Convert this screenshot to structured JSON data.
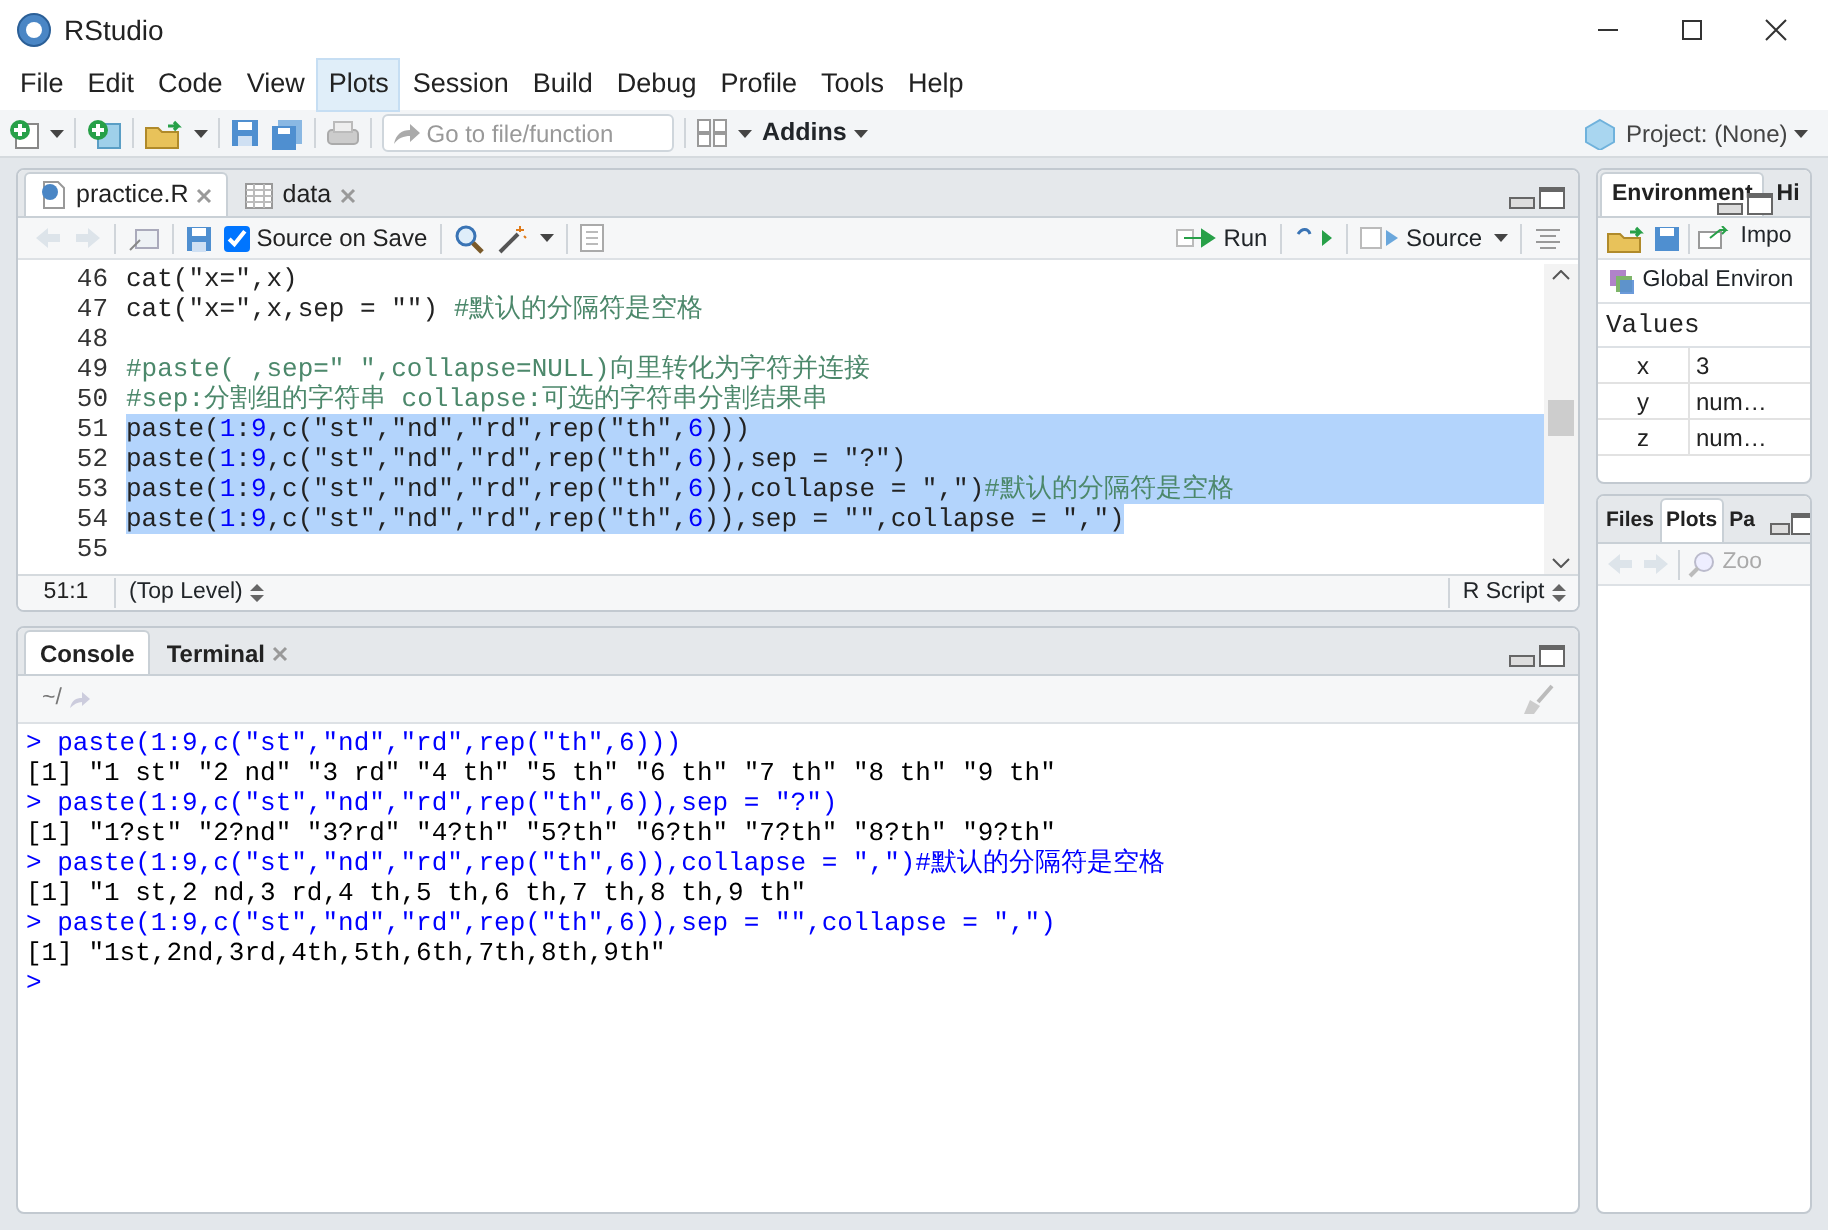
{
  "window": {
    "title": "RStudio"
  },
  "menu": [
    {
      "label": "File",
      "selected": false
    },
    {
      "label": "Edit",
      "selected": false
    },
    {
      "label": "Code",
      "selected": false
    },
    {
      "label": "View",
      "selected": false
    },
    {
      "label": "Plots",
      "selected": true
    },
    {
      "label": "Session",
      "selected": false
    },
    {
      "label": "Build",
      "selected": false
    },
    {
      "label": "Debug",
      "selected": false
    },
    {
      "label": "Profile",
      "selected": false
    },
    {
      "label": "Tools",
      "selected": false
    },
    {
      "label": "Help",
      "selected": false
    }
  ],
  "toolbar": {
    "goto_placeholder": "Go to file/function",
    "addins": "Addins",
    "project": "Project: (None)"
  },
  "editor": {
    "tabs": [
      {
        "label": "practice.R",
        "selected": true,
        "kind": "script"
      },
      {
        "label": "data",
        "selected": false,
        "kind": "table"
      }
    ],
    "source_on_save": {
      "label": "Source on Save",
      "checked": true
    },
    "run": "Run",
    "source": "Source",
    "lines": [
      {
        "number": "46",
        "text": "cat(\"x=\",x)",
        "selected": false
      },
      {
        "number": "47",
        "text": "cat(\"x=\",x,sep = \"\") #默认的分隔符是空格",
        "selected": false
      },
      {
        "number": "48",
        "selected": false
      },
      {
        "number": "49",
        "text": "#paste( ,sep=\" \",collapse=NULL)向里转化为字符并连接",
        "selected": false
      },
      {
        "number": "50",
        "text": "#sep:分割组的字符串 collapse:可选的字符串分割结果串",
        "selected": false
      },
      {
        "number": "51",
        "text": "paste(1:9,c(\"st\",\"nd\",\"rd\",rep(\"th\",6)))",
        "selected": true
      },
      {
        "number": "52",
        "text": "paste(1:9,c(\"st\",\"nd\",\"rd\",rep(\"th\",6)),sep = \"?\")",
        "selected": true
      },
      {
        "number": "53",
        "text": "paste(1:9,c(\"st\",\"nd\",\"rd\",rep(\"th\",6)),collapse = \",\")#默认的分隔符是空格",
        "selected": true
      },
      {
        "number": "54",
        "text": "paste(1:9,c(\"st\",\"nd\",\"rd\",rep(\"th\",6)),sep = \"\",collapse = \",\")",
        "selected": true
      },
      {
        "number": "55",
        "selected": false
      }
    ],
    "status": {
      "position": "51:1",
      "scope": "(Top Level)",
      "filetype": "R Script"
    }
  },
  "console": {
    "tabs": [
      {
        "label": "Console",
        "selected": true,
        "closable": false
      },
      {
        "label": "Terminal",
        "selected": false,
        "closable": true
      }
    ],
    "path": "~/",
    "lines": [
      {
        "kind": "input",
        "text": "> paste(1:9,c(\"st\",\"nd\",\"rd\",rep(\"th\",6)))"
      },
      {
        "kind": "output",
        "text": "[1] \"1 st\" \"2 nd\" \"3 rd\" \"4 th\" \"5 th\" \"6 th\" \"7 th\" \"8 th\" \"9 th\""
      },
      {
        "kind": "input",
        "text": "> paste(1:9,c(\"st\",\"nd\",\"rd\",rep(\"th\",6)),sep = \"?\")"
      },
      {
        "kind": "output",
        "text": "[1] \"1?st\" \"2?nd\" \"3?rd\" \"4?th\" \"5?th\" \"6?th\" \"7?th\" \"8?th\" \"9?th\""
      },
      {
        "kind": "input",
        "text": "> paste(1:9,c(\"st\",\"nd\",\"rd\",rep(\"th\",6)),collapse = \",\")#默认的分隔符是空格"
      },
      {
        "kind": "output",
        "text": "[1] \"1 st,2 nd,3 rd,4 th,5 th,6 th,7 th,8 th,9 th\""
      },
      {
        "kind": "input",
        "text": "> paste(1:9,c(\"st\",\"nd\",\"rd\",rep(\"th\",6)),sep = \"\",collapse = \",\")"
      },
      {
        "kind": "output",
        "text": "[1] \"1st,2nd,3rd,4th,5th,6th,7th,8th,9th\""
      },
      {
        "kind": "input",
        "text": ">"
      }
    ]
  },
  "environment": {
    "tabs": [
      {
        "label": "Environment",
        "selected": true
      },
      {
        "label": "Hi",
        "selected": false
      }
    ],
    "import": "Impo",
    "scope": "Global Environ",
    "section": "Values",
    "rows": [
      {
        "name": "x",
        "value": "3"
      },
      {
        "name": "y",
        "value": "num…"
      },
      {
        "name": "z",
        "value": "num…"
      }
    ]
  },
  "files": {
    "tabs": [
      {
        "label": "Files",
        "selected": false
      },
      {
        "label": "Plots",
        "selected": true
      },
      {
        "label": "Pa",
        "selected": false
      }
    ],
    "zoom": "Zoo"
  }
}
